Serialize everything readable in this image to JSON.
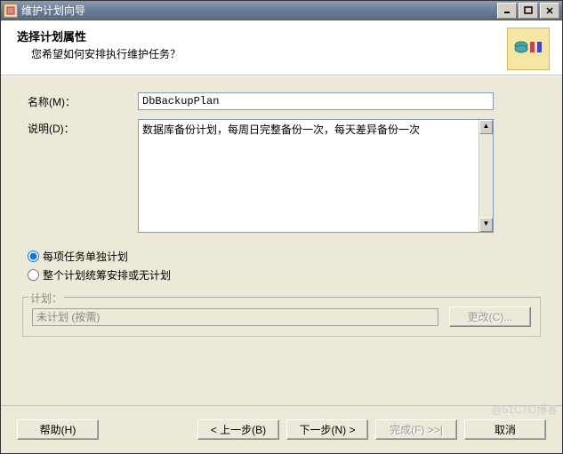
{
  "window": {
    "title": "维护计划向导"
  },
  "header": {
    "heading": "选择计划属性",
    "subheading": "您希望如何安排执行维护任务？"
  },
  "form": {
    "name_label": "名称(M)：",
    "name_value": "DbBackupPlan",
    "desc_label": "说明(D)：",
    "desc_value": "数据库备份计划，每周日完整备份一次，每天差异备份一次"
  },
  "schedule_mode": {
    "option1": "每项任务单独计划",
    "option2": "整个计划统筹安排或无计划",
    "selected": "option1"
  },
  "schedule_box": {
    "legend": "计划：",
    "field_value": "未计划 (按需)",
    "change_button": "更改(C)..."
  },
  "footer": {
    "help": "帮助(H)",
    "back": "< 上一步(B)",
    "next": "下一步(N) >",
    "finish": "完成(F) >>|",
    "cancel": "取消"
  },
  "watermark": "@51CTO博客"
}
